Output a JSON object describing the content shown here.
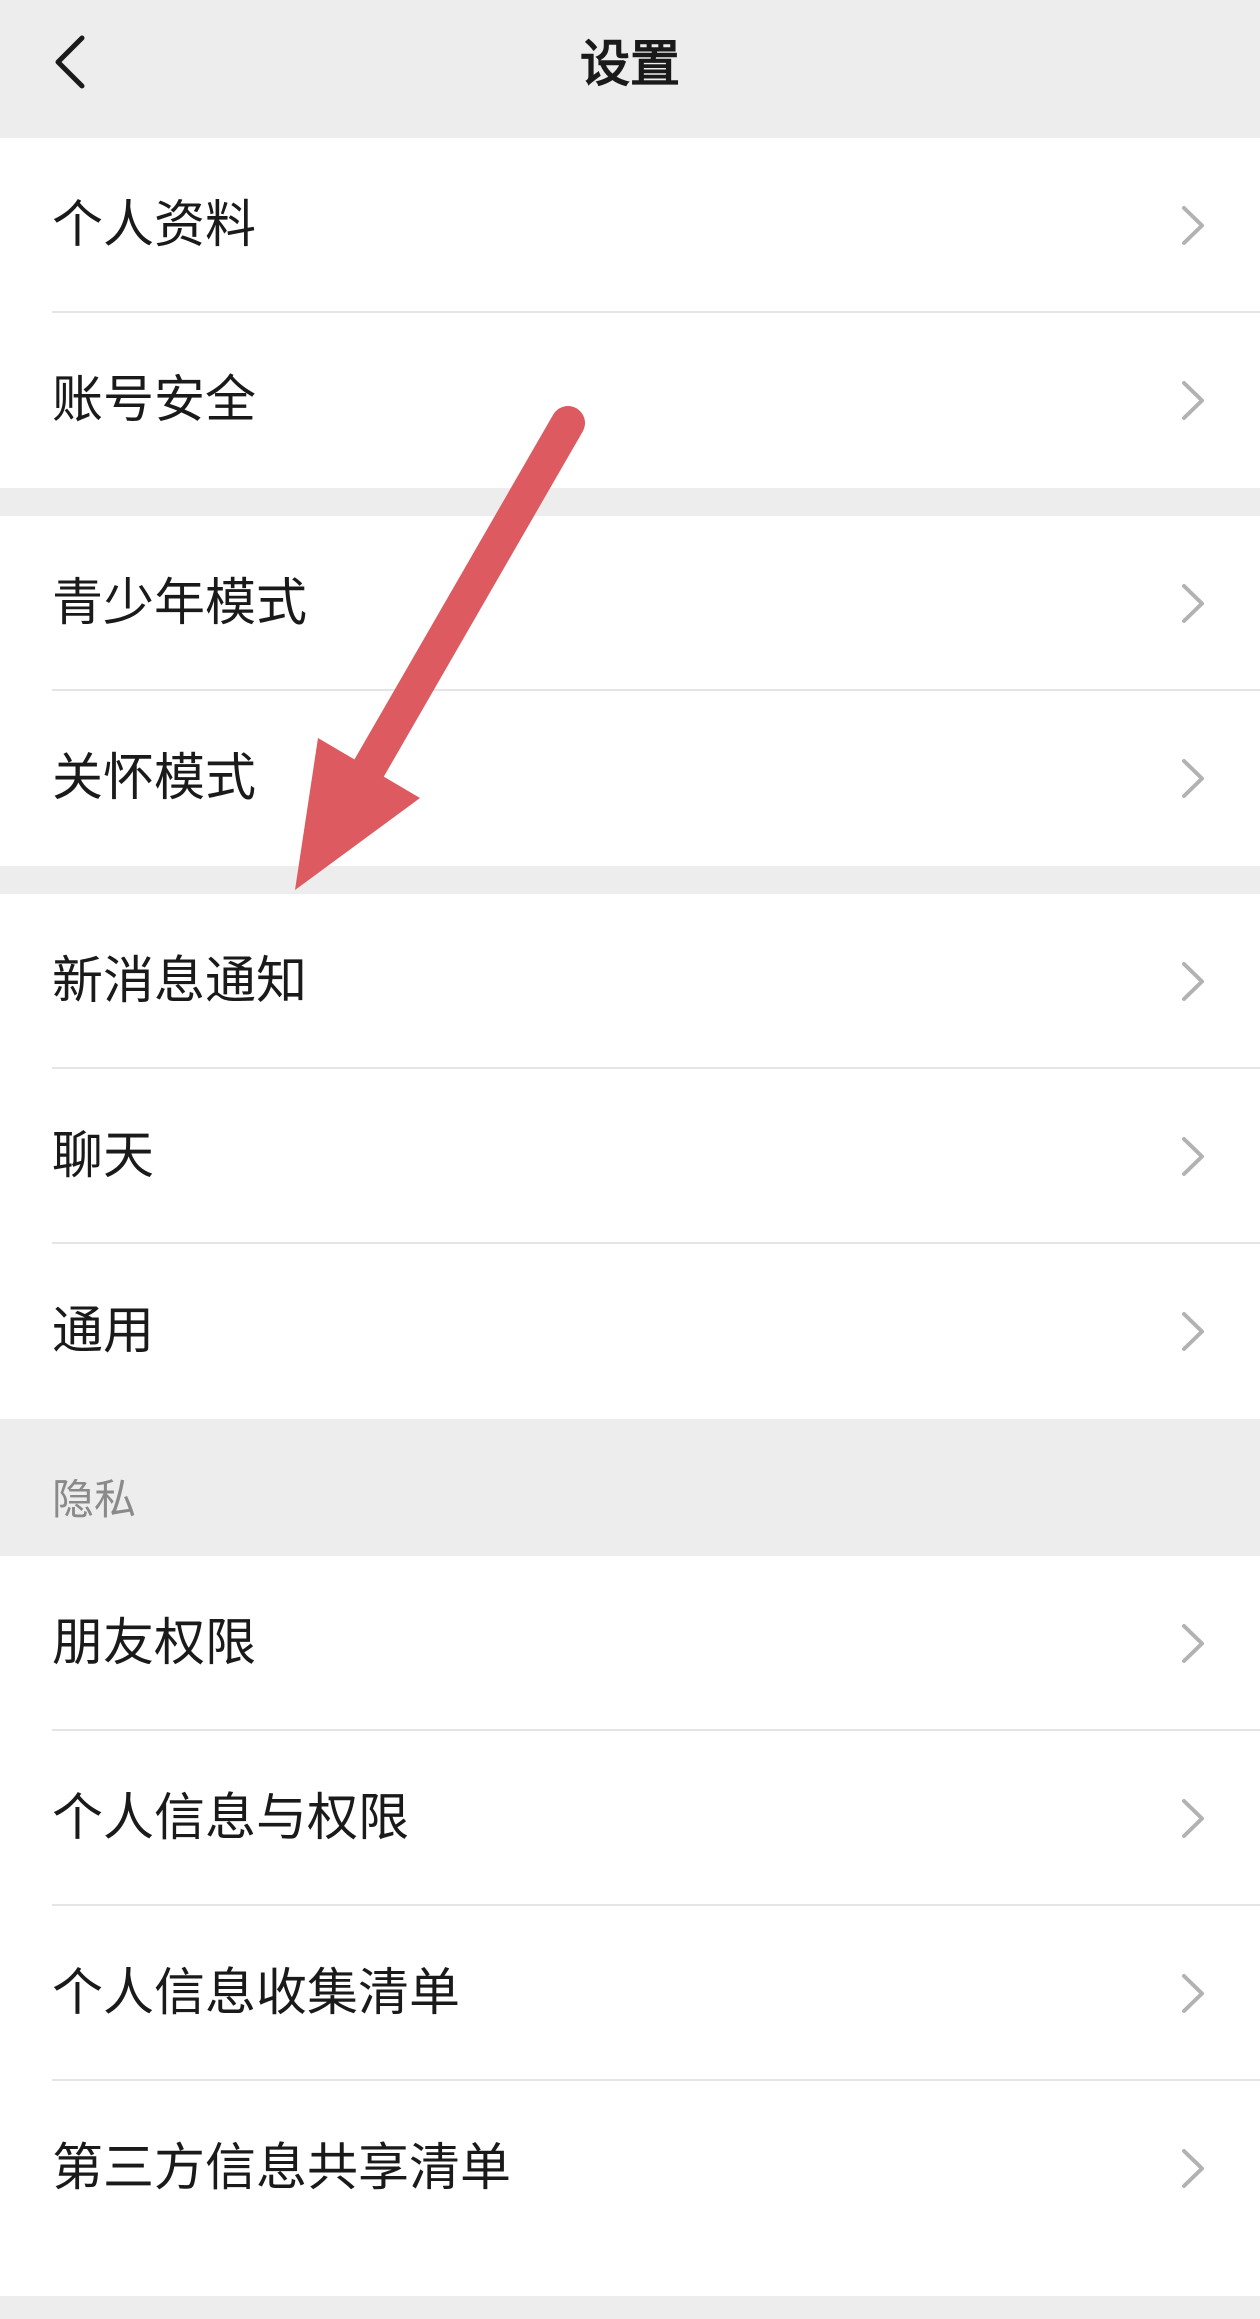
{
  "nav": {
    "title": "设置"
  },
  "groups": [
    {
      "items": [
        {
          "label": "个人资料"
        },
        {
          "label": "账号安全"
        }
      ]
    },
    {
      "items": [
        {
          "label": "青少年模式"
        },
        {
          "label": "关怀模式"
        }
      ]
    },
    {
      "items": [
        {
          "label": "新消息通知"
        },
        {
          "label": "聊天"
        },
        {
          "label": "通用"
        }
      ]
    },
    {
      "header": "隐私",
      "items": [
        {
          "label": "朋友权限"
        },
        {
          "label": "个人信息与权限"
        },
        {
          "label": "个人信息收集清单"
        },
        {
          "label": "第三方信息共享清单"
        }
      ]
    }
  ],
  "colors": {
    "annotation_arrow": "#dc5a60",
    "chevron": "#b2b2b2",
    "background": "#ededed"
  }
}
